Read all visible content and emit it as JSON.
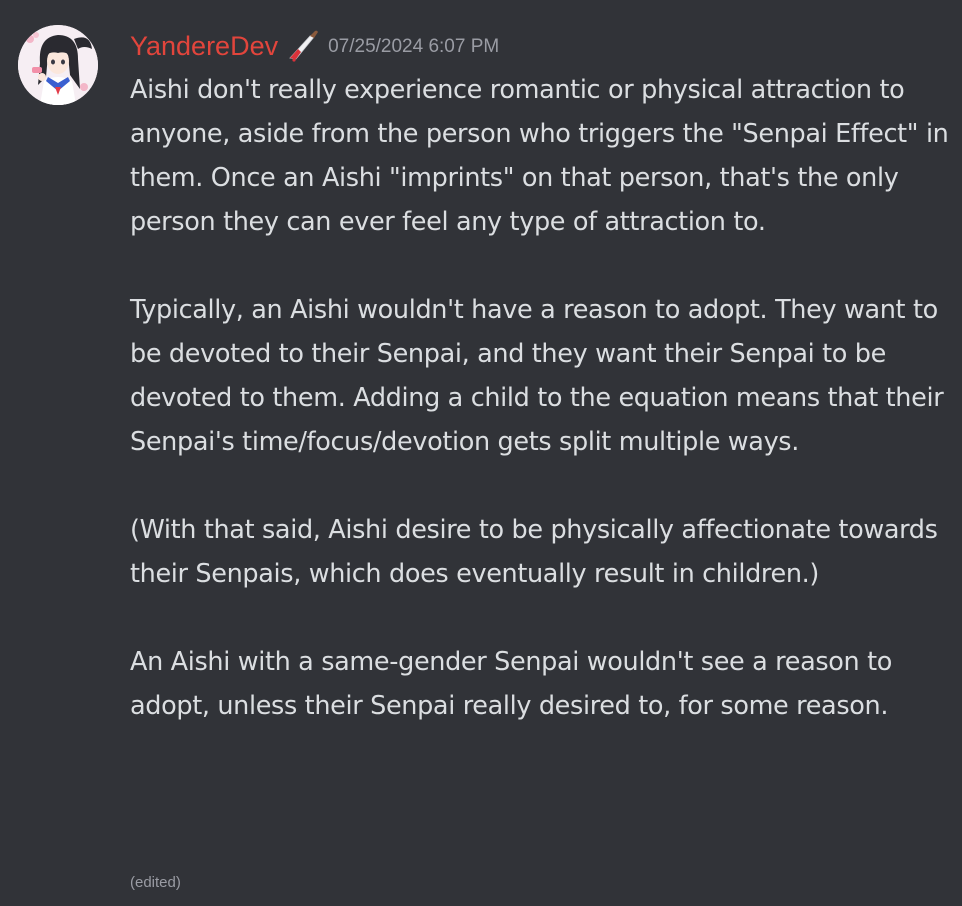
{
  "message": {
    "username": "YandereDev",
    "role_icon": "knife-icon",
    "timestamp": "07/25/2024 6:07 PM",
    "paragraphs": [
      "Aishi don't really experience romantic or physical attraction to anyone, aside from the person who triggers the \"Senpai Effect\" in them. Once an Aishi \"imprints\" on that person, that's the only person they can ever feel any type of attraction to.",
      "Typically, an Aishi wouldn't have a reason to adopt. They want to be devoted to their Senpai, and they want their Senpai to be devoted to them. Adding a child to the equation means that their Senpai's time/focus/devotion gets split multiple ways.",
      "(With that said, Aishi desire to be physically affectionate towards their Senpais, which does eventually result in children.)",
      "An Aishi with a same-gender Senpai wouldn't see a reason to adopt, unless their Senpai really desired to, for some reason."
    ],
    "edited_label": "(edited)"
  },
  "colors": {
    "background": "#313338",
    "username": "#e2453c",
    "text": "#dbdee1",
    "muted": "#9a9ca4"
  }
}
